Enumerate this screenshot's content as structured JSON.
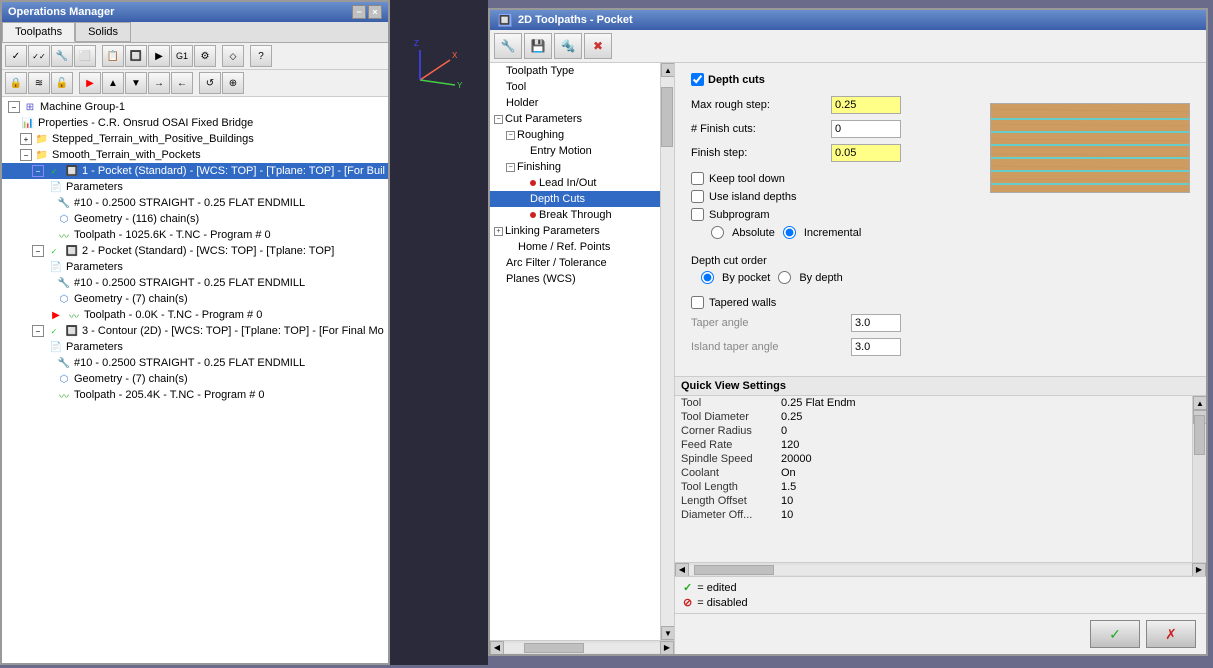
{
  "opsManager": {
    "title": "Operations Manager",
    "tabs": [
      "Toolpaths",
      "Solids"
    ],
    "activeTab": "Toolpaths",
    "titleButtons": [
      "-",
      "×"
    ],
    "toolbar1": [
      "select-all",
      "select-none",
      "select-ops",
      "select-geo",
      "toolpath-list",
      "material",
      "verify",
      "sim-selected",
      "cimco",
      "help"
    ],
    "toolbar2": [
      "lock",
      "waves",
      "unlock",
      "red-arrow",
      "up",
      "down",
      "indent",
      "outdent",
      "refresh",
      "add-geo"
    ],
    "tree": {
      "items": [
        {
          "id": "machine-group",
          "label": "Machine Group-1",
          "indent": 0,
          "type": "group",
          "expanded": true
        },
        {
          "id": "properties",
          "label": "Properties - C.R. Onsrud OSAI Fixed Bridge",
          "indent": 1,
          "type": "property"
        },
        {
          "id": "stepped-terrain",
          "label": "Stepped_Terrain_with_Positive_Buildings",
          "indent": 1,
          "type": "folder"
        },
        {
          "id": "smooth-terrain",
          "label": "Smooth_Terrain_with_Pockets",
          "indent": 1,
          "type": "folder"
        },
        {
          "id": "pocket1",
          "label": "1 - Pocket (Standard) - [WCS: TOP] - [Tplane: TOP] - [For Buil",
          "indent": 2,
          "type": "op",
          "selected": true,
          "enabled": true
        },
        {
          "id": "params1",
          "label": "Parameters",
          "indent": 3,
          "type": "params"
        },
        {
          "id": "tool1",
          "label": "#10 - 0.2500 STRAIGHT - 0.25 FLAT ENDMILL",
          "indent": 4,
          "type": "tool"
        },
        {
          "id": "geo1",
          "label": "Geometry - (116) chain(s)",
          "indent": 4,
          "type": "geo"
        },
        {
          "id": "path1",
          "label": "Toolpath - 1025.6K - T.NC - Program # 0",
          "indent": 4,
          "type": "toolpath"
        },
        {
          "id": "pocket2",
          "label": "2 - Pocket (Standard) - [WCS: TOP] - [Tplane: TOP]",
          "indent": 2,
          "type": "op",
          "enabled": true
        },
        {
          "id": "params2",
          "label": "Parameters",
          "indent": 3,
          "type": "params"
        },
        {
          "id": "tool2",
          "label": "#10 - 0.2500 STRAIGHT - 0.25 FLAT ENDMILL",
          "indent": 4,
          "type": "tool"
        },
        {
          "id": "geo2",
          "label": "Geometry - (7) chain(s)",
          "indent": 4,
          "type": "geo"
        },
        {
          "id": "path2",
          "label": "Toolpath - 0.0K - T.NC - Program # 0",
          "indent": 4,
          "type": "toolpath",
          "warning": true
        },
        {
          "id": "contour3",
          "label": "3 - Contour (2D) - [WCS: TOP] - [Tplane: TOP] - [For Final Mo",
          "indent": 2,
          "type": "op",
          "enabled": true
        },
        {
          "id": "params3",
          "label": "Parameters",
          "indent": 3,
          "type": "params"
        },
        {
          "id": "tool3",
          "label": "#10 - 0.2500 STRAIGHT - 0.25 FLAT ENDMILL",
          "indent": 4,
          "type": "tool"
        },
        {
          "id": "geo3",
          "label": "Geometry - (7) chain(s)",
          "indent": 4,
          "type": "geo"
        },
        {
          "id": "path3",
          "label": "Toolpath - 205.4K - T.NC - Program # 0",
          "indent": 4,
          "type": "toolpath"
        }
      ]
    }
  },
  "toolpathsDialog": {
    "title": "2D Toolpaths - Pocket",
    "toolbar": {
      "buttons": [
        "tool-icon",
        "save-icon",
        "holder-icon",
        "delete-icon"
      ]
    },
    "navTree": {
      "items": [
        {
          "label": "Toolpath Type",
          "indent": 0,
          "type": "leaf"
        },
        {
          "label": "Tool",
          "indent": 0,
          "type": "leaf"
        },
        {
          "label": "Holder",
          "indent": 0,
          "type": "leaf"
        },
        {
          "label": "Cut Parameters",
          "indent": 0,
          "type": "parent",
          "expanded": true
        },
        {
          "label": "Roughing",
          "indent": 1,
          "type": "leaf"
        },
        {
          "label": "Entry Motion",
          "indent": 2,
          "type": "leaf"
        },
        {
          "label": "Finishing",
          "indent": 1,
          "type": "leaf"
        },
        {
          "label": "Lead In/Out",
          "indent": 2,
          "type": "leaf",
          "error": true
        },
        {
          "label": "Depth Cuts",
          "indent": 2,
          "type": "leaf",
          "selected": true
        },
        {
          "label": "Break Through",
          "indent": 2,
          "type": "leaf",
          "error": true
        },
        {
          "label": "Linking Parameters",
          "indent": 0,
          "type": "parent"
        },
        {
          "label": "Home / Ref. Points",
          "indent": 1,
          "type": "leaf"
        },
        {
          "label": "Arc Filter / Tolerance",
          "indent": 0,
          "type": "leaf"
        },
        {
          "label": "Planes (WCS)",
          "indent": 0,
          "type": "leaf"
        }
      ]
    },
    "depthCuts": {
      "sectionTitle": "Depth cuts",
      "enabled": true,
      "maxRoughStep": {
        "label": "Max rough step:",
        "value": "0.25"
      },
      "finishCuts": {
        "label": "# Finish cuts:",
        "value": "0"
      },
      "finishStep": {
        "label": "Finish step:",
        "value": "0.05"
      },
      "keepToolDown": {
        "label": "Keep tool down",
        "checked": false
      },
      "useIslandDepths": {
        "label": "Use island depths",
        "checked": false
      },
      "subprogram": {
        "label": "Subprogram",
        "checked": false
      },
      "absoluteLabel": "Absolute",
      "incrementalLabel": "Incremental",
      "incrementalChecked": true,
      "depthCutOrder": {
        "label": "Depth cut order",
        "byPocket": "By pocket",
        "byDepth": "By depth",
        "selectedOption": "By pocket"
      },
      "taperedWalls": {
        "label": "Tapered walls",
        "checked": false,
        "taperAngle": {
          "label": "Taper angle",
          "value": "3.0"
        },
        "islandTaperAngle": {
          "label": "Island taper angle",
          "value": "3.0"
        }
      }
    },
    "quickView": {
      "header": "Quick View Settings",
      "rows": [
        {
          "label": "Tool",
          "value": "0.25 Flat Endm"
        },
        {
          "label": "Tool Diameter",
          "value": "0.25"
        },
        {
          "label": "Corner Radius",
          "value": "0"
        },
        {
          "label": "Feed Rate",
          "value": "120"
        },
        {
          "label": "Spindle Speed",
          "value": "20000"
        },
        {
          "label": "Coolant",
          "value": "On"
        },
        {
          "label": "Tool Length",
          "value": "1.5"
        },
        {
          "label": "Length Offset",
          "value": "10"
        },
        {
          "label": "Diameter Off...",
          "value": "10"
        }
      ]
    },
    "statusBar": {
      "editedLabel": "= edited",
      "disabledLabel": "= disabled"
    },
    "footer": {
      "okIcon": "✓",
      "cancelIcon": "✗"
    }
  }
}
